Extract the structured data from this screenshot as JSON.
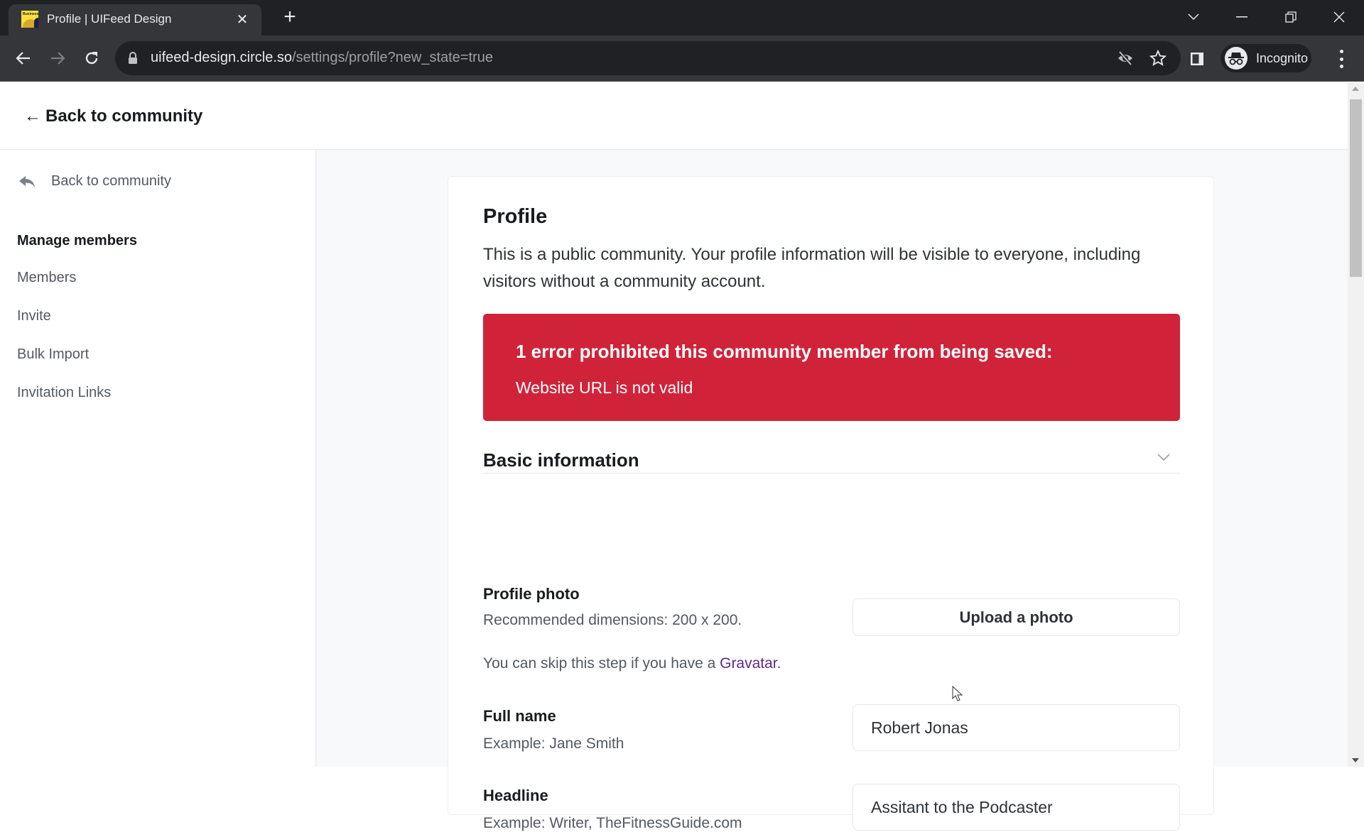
{
  "browser": {
    "tab_title": "Profile | UIFeed Design",
    "favicon_text": "Business",
    "url_host": "uifeed-design.circle.so",
    "url_path": "/settings/profile?new_state=true",
    "profile_label": "Incognito"
  },
  "header": {
    "back_arrow": "←",
    "back_label": "Back to community"
  },
  "sidebar": {
    "back_label": "Back to community",
    "section_heading": "Manage members",
    "items": [
      {
        "label": "Members"
      },
      {
        "label": "Invite"
      },
      {
        "label": "Bulk Import"
      },
      {
        "label": "Invitation Links"
      }
    ]
  },
  "main": {
    "title": "Profile",
    "description": "This is a public community. Your profile information will be visible to everyone, including visitors without a community account.",
    "error": {
      "title": "1 error prohibited this community member from being saved:",
      "message": "Website URL is not valid",
      "color": "#d0233a"
    },
    "section_title": "Basic information",
    "profile_photo": {
      "label": "Profile photo",
      "help": "Recommended dimensions: 200 x 200.",
      "gravatar_prefix": "You can skip this step if you have a ",
      "gravatar_link": "Gravatar",
      "gravatar_suffix": ".",
      "upload_label": "Upload a photo"
    },
    "full_name": {
      "label": "Full name",
      "help": "Example: Jane Smith",
      "value": "Robert Jonas"
    },
    "headline": {
      "label": "Headline",
      "help": "Example: Writer, TheFitnessGuide.com",
      "value": "Assitant to the Podcaster"
    }
  }
}
